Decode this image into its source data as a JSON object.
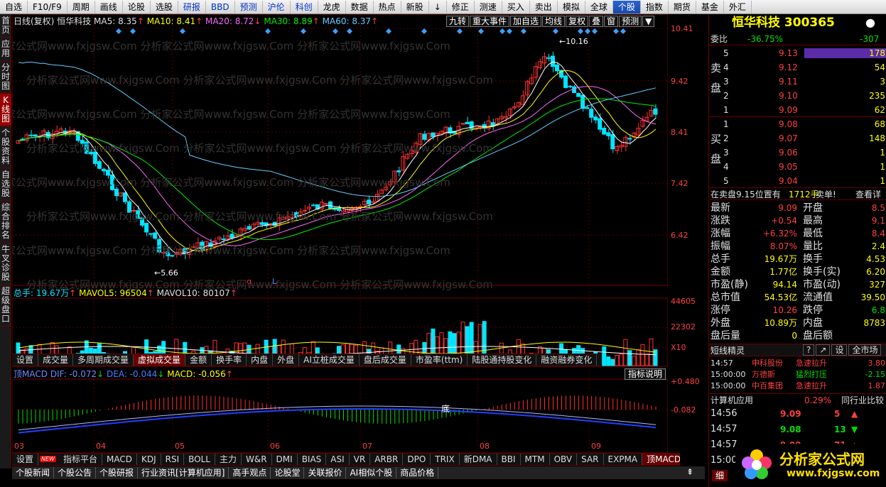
{
  "toolbar": [
    "自选",
    "F10/F9",
    "周期",
    "画线",
    "论股",
    "选股",
    "研报",
    "BBD",
    "预测",
    "沪伦",
    "科创",
    "龙虎",
    "数据",
    "热点",
    "新股",
    "↓",
    "修正",
    "测速",
    "买入",
    "卖出",
    "模拟",
    "全球",
    "个股",
    "指数",
    "期货",
    "基金",
    "外汇"
  ],
  "left_sidebar": [
    "首页",
    "应用",
    "分时图",
    "K线图",
    "个股资料",
    "自选股",
    "综合排名",
    "牛叉诊股",
    "超级盘口"
  ],
  "chart": {
    "header": {
      "period": "日线(复权)",
      "name": "恒华科技",
      "ma5": "MA5: 8.35",
      "ma10": "MA10: 8.41",
      "ma20": "MA20: 8.72",
      "ma30": "MA30: 8.89",
      "ma60": "MA60: 8.37"
    },
    "buttons": [
      "九转",
      "重大事件",
      "加自选",
      "均线",
      "复权",
      "叠",
      "窗",
      "预测"
    ],
    "price_axis": [
      "10.41",
      "9.42",
      "8.41",
      "7.42",
      "6.42"
    ],
    "high_label": "10.16",
    "low_label": "5.66",
    "markers": [
      "q",
      "L"
    ],
    "volume_header": {
      "total": "总手: 19.67万",
      "mavol5": "MAVOL5: 96504",
      "mavol10": "MAVOL10: 80107"
    },
    "volume_axis": [
      "44605",
      "22302",
      "X10"
    ],
    "indicator_tabs": [
      "设置",
      "成交量",
      "多周期成交量",
      "虚拟成交量",
      "金额",
      "换手率",
      "内盘",
      "外盘",
      "AI立桩成交量",
      "盘后成交量",
      "市盈率(ttm)",
      "陆股通持股变化",
      "融资融券变化"
    ],
    "macd_header": {
      "name": "顶MACD",
      "dif": "DIF: -0.072",
      "dea": "DEA: -0.044",
      "macd": "MACD: -0.056"
    },
    "macd_button": "指标说明",
    "macd_axis": [
      "+0.480",
      "-0.082"
    ],
    "macd_label": "底",
    "months": [
      "03",
      "04",
      "05",
      "06",
      "07",
      "08",
      "09"
    ],
    "bottom_tabs": [
      "设置",
      "NEW",
      "指标平台",
      "MACD",
      "KDJ",
      "RSI",
      "BOLL",
      "主力",
      "W&R",
      "DMI",
      "BIAS",
      "ASI",
      "VR",
      "ARBR",
      "DPO",
      "TRIX",
      "新DMA",
      "BBI",
      "MTM",
      "OBV",
      "SAR",
      "EXPMA",
      "顶MACD"
    ]
  },
  "news_bar": [
    "个股新闻",
    "个股公告",
    "个股研报",
    "行业资讯[计算机应用]",
    "高手观点",
    "论股堂",
    "关联报价",
    "AI相似个股",
    "商品价格"
  ],
  "quote": {
    "title": "恒华科技 300365",
    "weibi": {
      "label": "委比",
      "value": "-36.75%",
      "diff": "-307"
    },
    "sell_side": "卖盘",
    "buy_side": "买盘",
    "asks": [
      [
        "5",
        "9.13",
        "178"
      ],
      [
        "4",
        "9.12",
        "54"
      ],
      [
        "3",
        "9.11",
        "3"
      ],
      [
        "2",
        "9.10",
        "235"
      ],
      [
        "1",
        "9.09",
        "62"
      ]
    ],
    "bids": [
      [
        "1",
        "9.08",
        "68"
      ],
      [
        "2",
        "9.07",
        "148"
      ],
      [
        "3",
        "9.06",
        "1"
      ],
      [
        "4",
        "9.05",
        "1"
      ],
      [
        "5",
        "9.04",
        "1"
      ]
    ],
    "info": {
      "text": "在卖盘9.15位置有",
      "vol": "1712手",
      "tag": "卖单!",
      "link": "查看详"
    },
    "stats": [
      [
        "最新",
        "9.09",
        "开盘",
        "8.5"
      ],
      [
        "涨跌",
        "+0.54",
        "最高",
        "9.1"
      ],
      [
        "涨幅",
        "+6.32%",
        "最低",
        "8.4"
      ],
      [
        "振幅",
        "8.07%",
        "量比",
        "2.4"
      ],
      [
        "总手",
        "19.67万",
        "换手",
        "4.53"
      ],
      [
        "金额",
        "1.77亿",
        "换手(实)",
        "6.20"
      ],
      [
        "市盈(静)",
        "94.14",
        "市盈(动)",
        "327"
      ],
      [
        "总市值",
        "54.53亿",
        "流通值",
        "39.50"
      ],
      [
        "涨停",
        "10.26",
        "跌停",
        "6.8"
      ],
      [
        "外盘",
        "10.89万",
        "内盘",
        "8783"
      ],
      [
        "盘后量",
        "0",
        "盘后额",
        ""
      ]
    ],
    "short_title": "短线精灵",
    "short_btns": [
      "?",
      "↗",
      "设",
      "全市场"
    ],
    "short_rows": [
      [
        "14:57",
        "申科股份",
        "急速拉升",
        "3.80"
      ],
      [
        "15:00:00",
        "万德斯",
        "猛烈打压",
        "-2.15"
      ],
      [
        "15:00:00",
        "中百集团",
        "急速拉升",
        "1.87"
      ]
    ],
    "industry": {
      "name": "计算机应用",
      "pct": "0.29%",
      "btn": "同行业比较"
    },
    "ticks": [
      [
        "14:56",
        "9.09",
        "5"
      ],
      [
        "14:57",
        "9.08",
        "13"
      ],
      [
        "14:57",
        "9.09",
        "71"
      ],
      [
        "15:00",
        "9.09",
        ""
      ]
    ],
    "bottom_tab": "细"
  },
  "logo": {
    "text": "分析家公式网",
    "url": "www.fxjgsw.com"
  },
  "colors": {
    "up": "#ff4040",
    "down": "#00e000",
    "ma5": "#ffffff",
    "ma10": "#ffff00",
    "ma20": "#ff66ff",
    "ma30": "#00ee00",
    "ma60": "#66ccff"
  }
}
